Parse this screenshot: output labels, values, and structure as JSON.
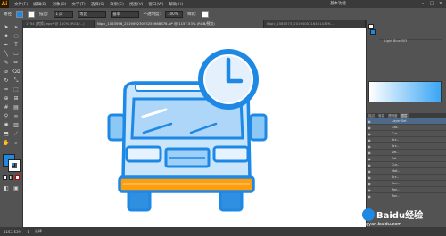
{
  "app": {
    "logo": "Ai"
  },
  "menu": {
    "items": [
      "文件(F)",
      "编辑(E)",
      "对象(O)",
      "文字(T)",
      "选择(S)",
      "效果(C)",
      "视图(V)",
      "窗口(W)",
      "帮助(H)"
    ],
    "workspace": "基本功能"
  },
  "control": {
    "object_label": "路径",
    "stroke_label": "描边:",
    "stroke_value": "1 pt",
    "profile_label": "等比",
    "brush_value": "基本",
    "opacity_label": "不透明度:",
    "opacity_value": "100%",
    "style_label": "样式:"
  },
  "tabs": [
    {
      "label": "1754 [转换].eps* @ 100% (RGB/...)",
      "active": false
    },
    {
      "label": "Nipic_1063596_20190923093252668876.ai* @ 1157.53% (RGB/预览)",
      "active": true
    },
    {
      "label": "Nipic_1580573_20190002164014359...",
      "active": false
    }
  ],
  "swatch_panel": {
    "color_name": "Light Blue 003"
  },
  "layers_panel": {
    "tabs": [
      "描边",
      "渐变",
      "透明度"
    ],
    "active_tab": "图层",
    "header": "Layer Set",
    "items": [
      "Gro..",
      "Cur..",
      "Arc..",
      "Arc..",
      "Sel..",
      "Sel..",
      "Cur..",
      "Mot..",
      "Arc..",
      "Rec..",
      "Rec..",
      "Rec.."
    ]
  },
  "status": {
    "zoom": "1157.53%",
    "page": "1",
    "mode": "选择"
  },
  "watermark": {
    "brand": "Baidu经验",
    "url": "jingyan.baidu.com"
  },
  "colors": {
    "accent_blue": "#1e88e5",
    "light_blue": "#bfe0fb",
    "orange": "#ff9800",
    "gray_bg": "#535353"
  }
}
